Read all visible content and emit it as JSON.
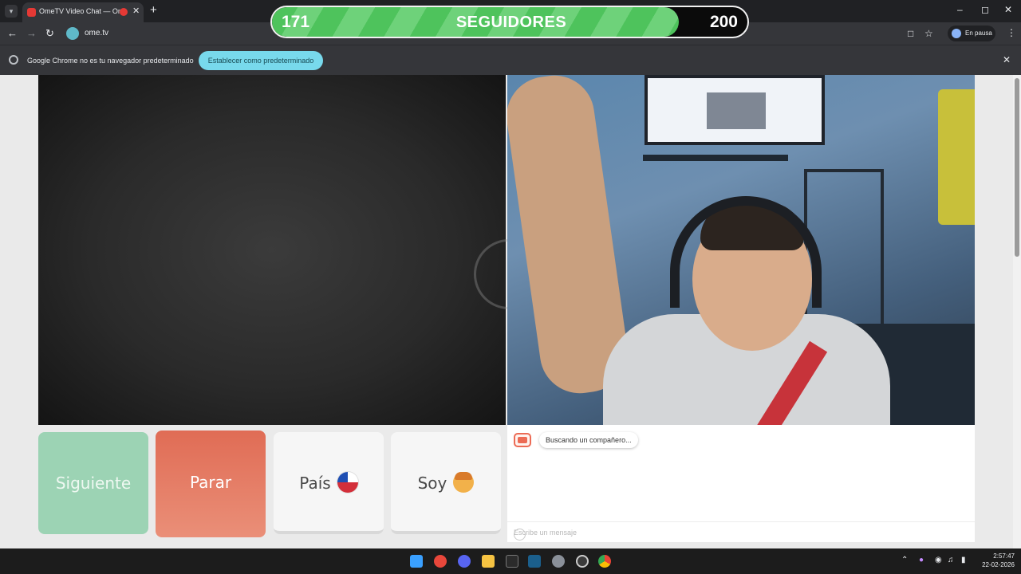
{
  "browser": {
    "tab_title": "OmeTV Video Chat — Omeg",
    "url": "ome.tv",
    "profile_status": "En pausa",
    "infobar_text": "Google Chrome no es tu navegador predeterminado",
    "infobar_button": "Establecer como predeterminado"
  },
  "followers": {
    "current": "171",
    "label": "SEGUIDORES",
    "goal": "200",
    "progress_fraction": 0.855
  },
  "controls": {
    "next_label": "Siguiente",
    "stop_label": "Parar",
    "country_label": "País",
    "me_label": "Soy"
  },
  "chat": {
    "status_message": "Buscando un compañero...",
    "input_placeholder": "Escribe un mensaje"
  },
  "taskbar": {
    "time": "2:57:47",
    "date": "22-02-2026"
  },
  "colors": {
    "next": "#9cd3b4",
    "stop": "#e06c55",
    "accent": "#78d9ec",
    "progress": "#4ec35c"
  }
}
